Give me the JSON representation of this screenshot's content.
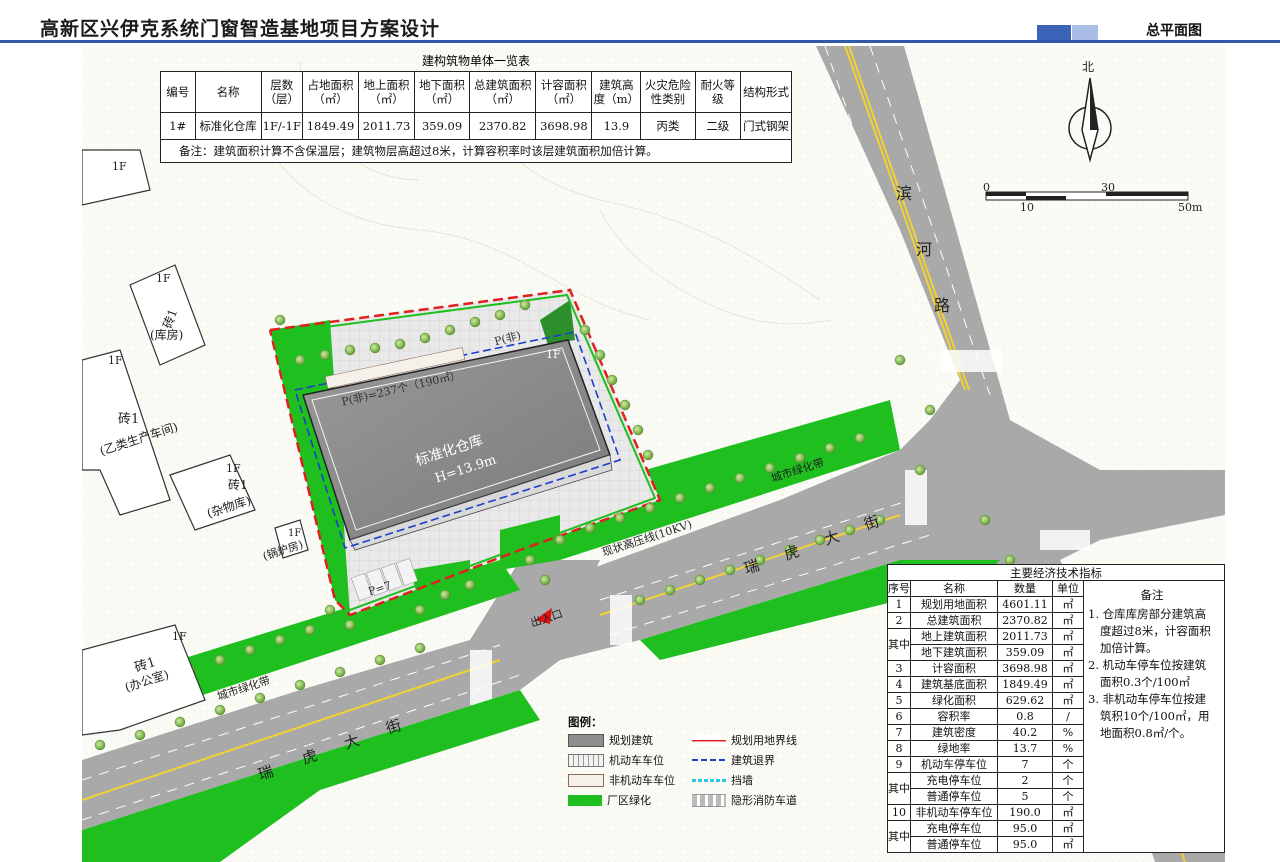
{
  "header": {
    "title": "高新区兴伊克系统门窗智造基地项目方案设计",
    "section": "总平面图"
  },
  "colors": {
    "accent": "#2f5aa8",
    "road": "#a9a9a9",
    "green": "#1fbf1f",
    "building": "#8e8e8e",
    "boundary": "#e02020",
    "setback": "#1a3fcc"
  },
  "building_table": {
    "caption": "建构筑物单体一览表",
    "headers": [
      "编号",
      "名称",
      "层数（层）",
      "占地面积（㎡）",
      "地上面积（㎡）",
      "地下面积（㎡）",
      "总建筑面积（㎡）",
      "计容面积（㎡）",
      "建筑高度（m）",
      "火灾危险性类别",
      "耐火等级",
      "结构形式"
    ],
    "rows": [
      [
        "1#",
        "标准化仓库",
        "1F/-1F",
        "1849.49",
        "2011.73",
        "359.09",
        "2370.82",
        "3698.98",
        "13.9",
        "丙类",
        "二级",
        "门式钢架"
      ]
    ],
    "note": "备注：建筑面积计算不含保温层；建筑物层高超过8米，计算容积率时该层建筑面积加倍计算。"
  },
  "compass": {
    "north": "北"
  },
  "scale": {
    "t0": "0",
    "t30": "30",
    "t10": "10",
    "t50": "50m"
  },
  "map": {
    "road_east": [
      "滨",
      "河",
      "路"
    ],
    "road_south": [
      "瑞",
      "虎",
      "大",
      "街"
    ],
    "road_south2": [
      "瑞",
      "虎",
      "大",
      "街"
    ],
    "greenbelt1": "城市绿化带",
    "greenbelt2": "城市绿化带",
    "hv_line": "现状高压线(10KV)",
    "entrance": "出入口",
    "warehouse": "标准化仓库",
    "warehouse_h": "H=13.9m",
    "parking_nm": "P(非)=237个（190㎡）",
    "parking_f": "P(非)",
    "parking_m": "P=7",
    "floor": "1F",
    "buildings": [
      {
        "floor": "1F",
        "name": "",
        "use": ""
      },
      {
        "floor": "1F",
        "name": "砖1",
        "use": "(库房)"
      },
      {
        "floor": "1F",
        "name": "砖1",
        "use": "(乙类生产车间)"
      },
      {
        "floor": "1F",
        "name": "砖1",
        "use": "(杂物库)"
      },
      {
        "floor": "1F",
        "name": "",
        "use": "(锅炉房)"
      },
      {
        "floor": "1F",
        "name": "砖1",
        "use": "(办公室)"
      }
    ]
  },
  "legend": {
    "title": "图例：",
    "items": [
      {
        "label": "规划建筑"
      },
      {
        "label": "规划用地界线"
      },
      {
        "label": "机动车车位"
      },
      {
        "label": "建筑退界"
      },
      {
        "label": "非机动车车位"
      },
      {
        "label": "挡墙"
      },
      {
        "label": "厂区绿化"
      },
      {
        "label": "隐形消防车道"
      }
    ]
  },
  "econ_table": {
    "caption": "主要经济技术指标",
    "headers": [
      "序号",
      "名称",
      "数量",
      "单位",
      "备注"
    ],
    "rows": [
      {
        "no": "1",
        "sub": "",
        "name": "规划用地面积",
        "value": "4601.11",
        "unit": "㎡"
      },
      {
        "no": "2",
        "sub": "",
        "name": "总建筑面积",
        "value": "2370.82",
        "unit": "㎡"
      },
      {
        "no": "其中",
        "sub": "",
        "name": "地上建筑面积",
        "value": "2011.73",
        "unit": "㎡"
      },
      {
        "no": "",
        "sub": "",
        "name": "地下建筑面积",
        "value": "359.09",
        "unit": "㎡"
      },
      {
        "no": "3",
        "sub": "",
        "name": "计容面积",
        "value": "3698.98",
        "unit": "㎡"
      },
      {
        "no": "4",
        "sub": "",
        "name": "建筑基底面积",
        "value": "1849.49",
        "unit": "㎡"
      },
      {
        "no": "5",
        "sub": "",
        "name": "绿化面积",
        "value": "629.62",
        "unit": "㎡"
      },
      {
        "no": "6",
        "sub": "",
        "name": "容积率",
        "value": "0.8",
        "unit": "/"
      },
      {
        "no": "7",
        "sub": "",
        "name": "建筑密度",
        "value": "40.2",
        "unit": "%"
      },
      {
        "no": "8",
        "sub": "",
        "name": "绿地率",
        "value": "13.7",
        "unit": "%"
      },
      {
        "no": "9",
        "sub": "",
        "name": "机动车停车位",
        "value": "7",
        "unit": "个"
      },
      {
        "no": "其中",
        "sub": "",
        "name": "充电停车位",
        "value": "2",
        "unit": "个"
      },
      {
        "no": "",
        "sub": "",
        "name": "普通停车位",
        "value": "5",
        "unit": "个"
      },
      {
        "no": "10",
        "sub": "",
        "name": "非机动车停车位",
        "value": "190.0",
        "unit": "㎡"
      },
      {
        "no": "其中",
        "sub": "",
        "name": "充电停车位",
        "value": "95.0",
        "unit": "㎡"
      },
      {
        "no": "",
        "sub": "",
        "name": "普通停车位",
        "value": "95.0",
        "unit": "㎡"
      }
    ],
    "notes": [
      "1. 仓库库房部分建筑高度超过8米，计容面积加倍计算。",
      "2. 机动车停车位按建筑面积0.3个/100㎡",
      "3. 非机动车停车位按建筑积10个/100㎡，用地面积0.8㎡/个。"
    ]
  }
}
